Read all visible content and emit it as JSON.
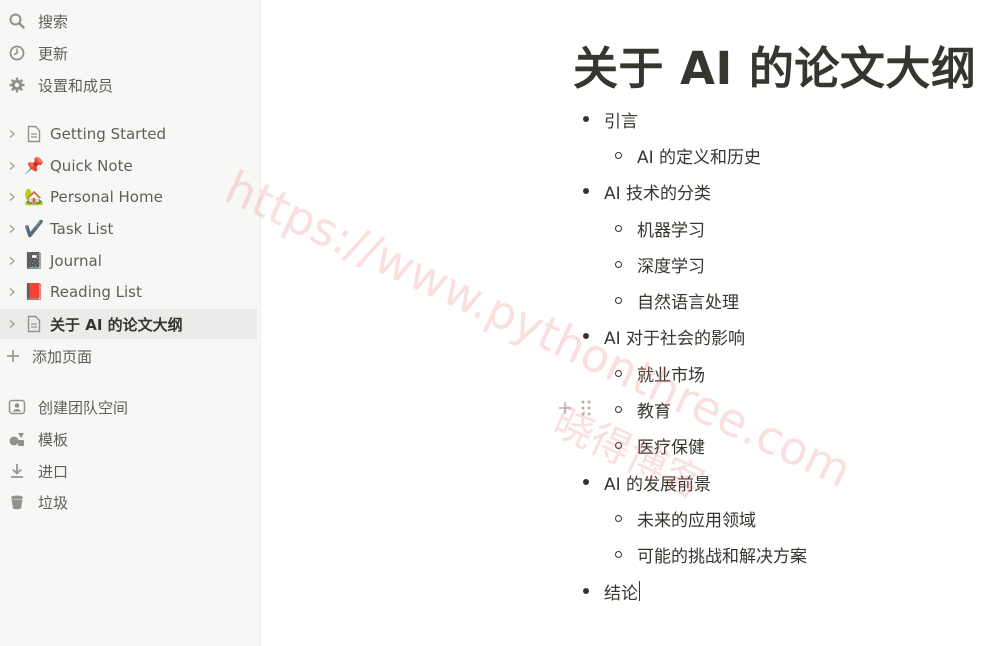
{
  "sidebar": {
    "top_items": [
      {
        "label": "搜索",
        "icon": "search-icon"
      },
      {
        "label": "更新",
        "icon": "clock-icon"
      },
      {
        "label": "设置和成员",
        "icon": "gear-icon"
      }
    ],
    "pages": [
      {
        "label": "Getting Started",
        "icon": "document-icon",
        "emoji": ""
      },
      {
        "label": "Quick Note",
        "icon": "pushpin-icon",
        "emoji": "📌"
      },
      {
        "label": "Personal Home",
        "icon": "house-icon",
        "emoji": "🏡"
      },
      {
        "label": "Task List",
        "icon": "checkmark-icon",
        "emoji": "✔️"
      },
      {
        "label": "Journal",
        "icon": "notebook-icon",
        "emoji": "📓"
      },
      {
        "label": "Reading List",
        "icon": "book-icon",
        "emoji": "📕"
      },
      {
        "label": "关于 AI 的论文大纲",
        "icon": "document-icon",
        "emoji": ""
      }
    ],
    "add_page_label": "添加页面",
    "bottom_items": [
      {
        "label": "创建团队空间",
        "icon": "team-space-icon"
      },
      {
        "label": "模板",
        "icon": "shapes-icon"
      },
      {
        "label": "进口",
        "icon": "download-icon"
      },
      {
        "label": "垃圾",
        "icon": "trash-icon"
      }
    ]
  },
  "page": {
    "title": "关于 AI 的论文大纲",
    "outline": [
      {
        "level": 1,
        "text": "引言"
      },
      {
        "level": 2,
        "text": "AI 的定义和历史"
      },
      {
        "level": 1,
        "text": "AI 技术的分类"
      },
      {
        "level": 2,
        "text": "机器学习"
      },
      {
        "level": 2,
        "text": "深度学习"
      },
      {
        "level": 2,
        "text": "自然语言处理"
      },
      {
        "level": 1,
        "text": "AI 对于社会的影响"
      },
      {
        "level": 2,
        "text": "就业市场"
      },
      {
        "level": 2,
        "text": "教育"
      },
      {
        "level": 2,
        "text": "医疗保健"
      },
      {
        "level": 1,
        "text": "AI 的发展前景"
      },
      {
        "level": 2,
        "text": "未来的应用领域"
      },
      {
        "level": 2,
        "text": "可能的挑战和解决方案"
      },
      {
        "level": 1,
        "text": "结论"
      }
    ]
  },
  "watermark": {
    "text": "https://www.pythonthree.com",
    "text2": "晓得博客"
  },
  "colors": {
    "sidebar_bg": "#f7f7f5",
    "active_row_bg": "#ebebea",
    "text_primary": "#37352f",
    "text_secondary": "#5f5e5b",
    "icon_gray": "#91918e",
    "watermark": "#e86e6e"
  }
}
